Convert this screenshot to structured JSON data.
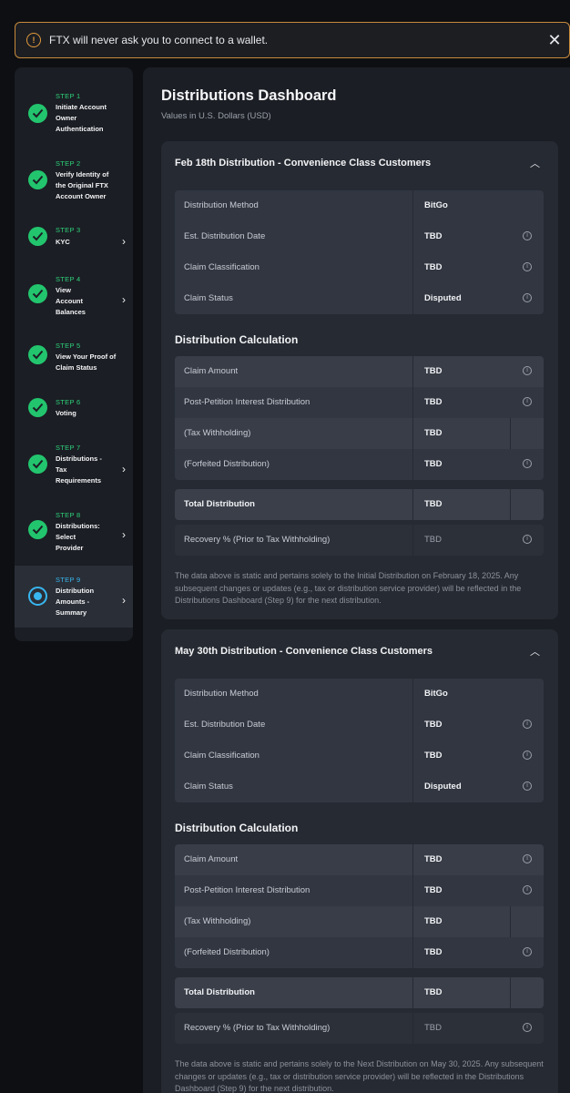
{
  "banner": {
    "text": "FTX will never ask you to connect to a wallet.",
    "icon": "warning-triangle-icon",
    "close_icon": "close-icon"
  },
  "sidebar": {
    "steps": [
      {
        "num": "STEP 1",
        "title": "Initiate Account Owner Authentication",
        "status": "complete",
        "chevron": false
      },
      {
        "num": "STEP 2",
        "title": "Verify Identity of the Original FTX Account Owner",
        "status": "complete",
        "chevron": false
      },
      {
        "num": "STEP 3",
        "title": "KYC",
        "status": "complete",
        "chevron": true
      },
      {
        "num": "STEP 4",
        "title": "View Account Balances",
        "status": "complete",
        "chevron": true
      },
      {
        "num": "STEP 5",
        "title": "View Your Proof of Claim Status",
        "status": "complete",
        "chevron": false
      },
      {
        "num": "STEP 6",
        "title": "Voting",
        "status": "complete",
        "chevron": false
      },
      {
        "num": "STEP 7",
        "title": "Distributions - Tax Requirements",
        "status": "complete",
        "chevron": true
      },
      {
        "num": "STEP 8",
        "title": "Distributions: Select Provider",
        "status": "complete",
        "chevron": true
      },
      {
        "num": "STEP 9",
        "title": "Distribution Amounts - Summary",
        "status": "current",
        "chevron": true
      }
    ]
  },
  "main": {
    "title": "Distributions Dashboard",
    "subtitle": "Values in U.S. Dollars (USD)",
    "cards": [
      {
        "title": "Feb 18th Distribution - Convenience Class Customers",
        "details": [
          {
            "label": "Distribution Method",
            "value": "BitGo",
            "info": false
          },
          {
            "label": "Est. Distribution Date",
            "value": "TBD",
            "info": true
          },
          {
            "label": "Claim Classification",
            "value": "TBD",
            "info": true
          },
          {
            "label": "Claim Status",
            "value": "Disputed",
            "info": true
          }
        ],
        "calc_title": "Distribution Calculation",
        "calc": [
          {
            "label": "Claim Amount",
            "value": "TBD",
            "info": true
          },
          {
            "label": "Post-Petition Interest Distribution",
            "value": "TBD",
            "info": true
          },
          {
            "label": "(Tax Withholding)",
            "value": "TBD",
            "info": false
          },
          {
            "label": "(Forfeited Distribution)",
            "value": "TBD",
            "info": true
          }
        ],
        "total": {
          "label": "Total Distribution",
          "value": "TBD"
        },
        "recovery": {
          "label": "Recovery % (Prior to Tax Withholding)",
          "value": "TBD"
        },
        "note": "The data above is static and pertains solely to the Initial Distribution on February 18, 2025. Any subsequent changes or updates (e.g., tax or distribution service provider) will be reflected in the Distributions Dashboard (Step 9) for the next distribution."
      },
      {
        "title": "May 30th Distribution - Convenience Class Customers",
        "details": [
          {
            "label": "Distribution Method",
            "value": "BitGo",
            "info": false
          },
          {
            "label": "Est. Distribution Date",
            "value": "TBD",
            "info": true
          },
          {
            "label": "Claim Classification",
            "value": "TBD",
            "info": true
          },
          {
            "label": "Claim Status",
            "value": "Disputed",
            "info": true
          }
        ],
        "calc_title": "Distribution Calculation",
        "calc": [
          {
            "label": "Claim Amount",
            "value": "TBD",
            "info": true
          },
          {
            "label": "Post-Petition Interest Distribution",
            "value": "TBD",
            "info": true
          },
          {
            "label": "(Tax Withholding)",
            "value": "TBD",
            "info": false
          },
          {
            "label": "(Forfeited Distribution)",
            "value": "TBD",
            "info": true
          }
        ],
        "total": {
          "label": "Total Distribution",
          "value": "TBD"
        },
        "recovery": {
          "label": "Recovery % (Prior to Tax Withholding)",
          "value": "TBD"
        },
        "note": "The data above is static and pertains solely to the Next Distribution on May 30, 2025. Any subsequent changes or updates (e.g., tax or distribution service provider) will be reflected in the Distributions Dashboard (Step 9) for the next distribution."
      }
    ]
  }
}
